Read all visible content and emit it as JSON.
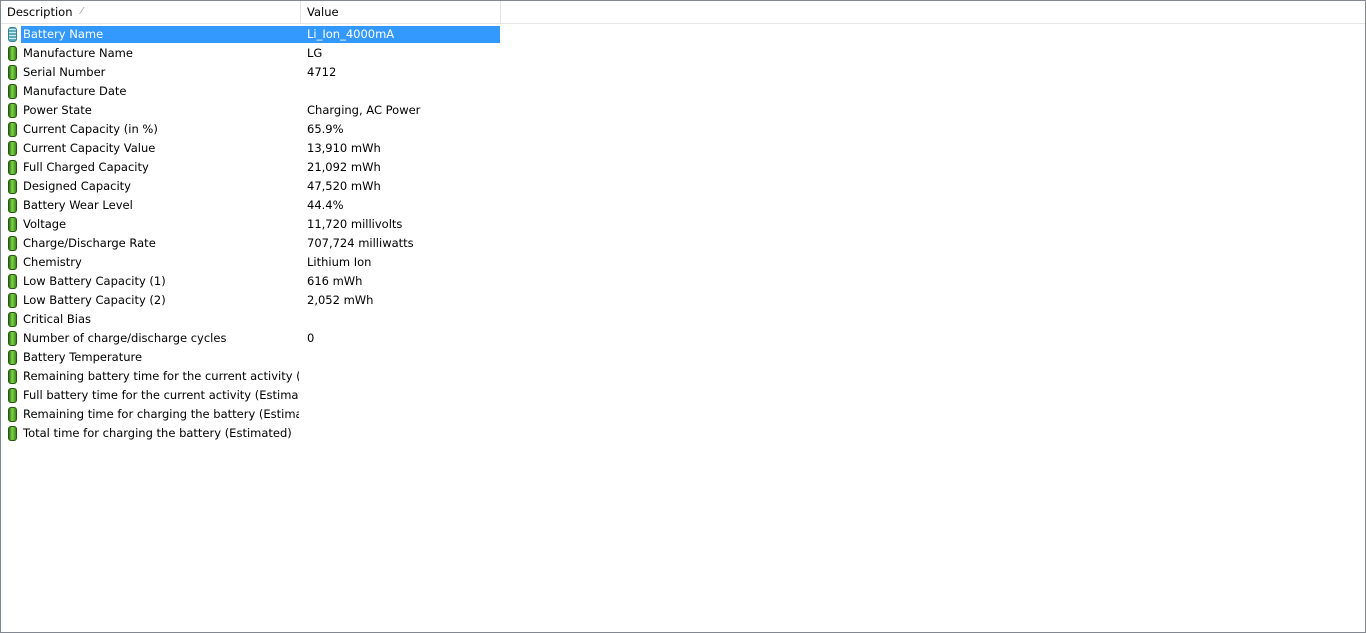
{
  "columns": {
    "description": "Description",
    "value": "Value"
  },
  "rows": [
    {
      "label": "Battery Name",
      "value": "Li_Ion_4000mA"
    },
    {
      "label": "Manufacture Name",
      "value": "LG"
    },
    {
      "label": "Serial Number",
      "value": "4712"
    },
    {
      "label": "Manufacture Date",
      "value": ""
    },
    {
      "label": "Power State",
      "value": "Charging, AC Power"
    },
    {
      "label": "Current Capacity (in %)",
      "value": "65.9%"
    },
    {
      "label": "Current Capacity Value",
      "value": "13,910 mWh"
    },
    {
      "label": "Full Charged Capacity",
      "value": "21,092 mWh"
    },
    {
      "label": "Designed Capacity",
      "value": "47,520 mWh"
    },
    {
      "label": "Battery Wear Level",
      "value": "44.4%"
    },
    {
      "label": "Voltage",
      "value": "11,720 millivolts"
    },
    {
      "label": "Charge/Discharge Rate",
      "value": "707,724 milliwatts"
    },
    {
      "label": "Chemistry",
      "value": "Lithium Ion"
    },
    {
      "label": "Low Battery Capacity (1)",
      "value": "616 mWh"
    },
    {
      "label": "Low Battery Capacity (2)",
      "value": "2,052 mWh"
    },
    {
      "label": "Critical Bias",
      "value": ""
    },
    {
      "label": "Number of charge/discharge cycles",
      "value": "0"
    },
    {
      "label": "Battery Temperature",
      "value": ""
    },
    {
      "label": "Remaining battery time for the current activity (Est...",
      "value": ""
    },
    {
      "label": "Full battery time for the current activity (Estimated)",
      "value": ""
    },
    {
      "label": "Remaining time for charging the battery (Estimated)",
      "value": ""
    },
    {
      "label": "Total  time for charging the battery (Estimated)",
      "value": ""
    }
  ],
  "selected_index": 0,
  "colors": {
    "selection": "#3399ff",
    "icon": "#4ea82a"
  }
}
